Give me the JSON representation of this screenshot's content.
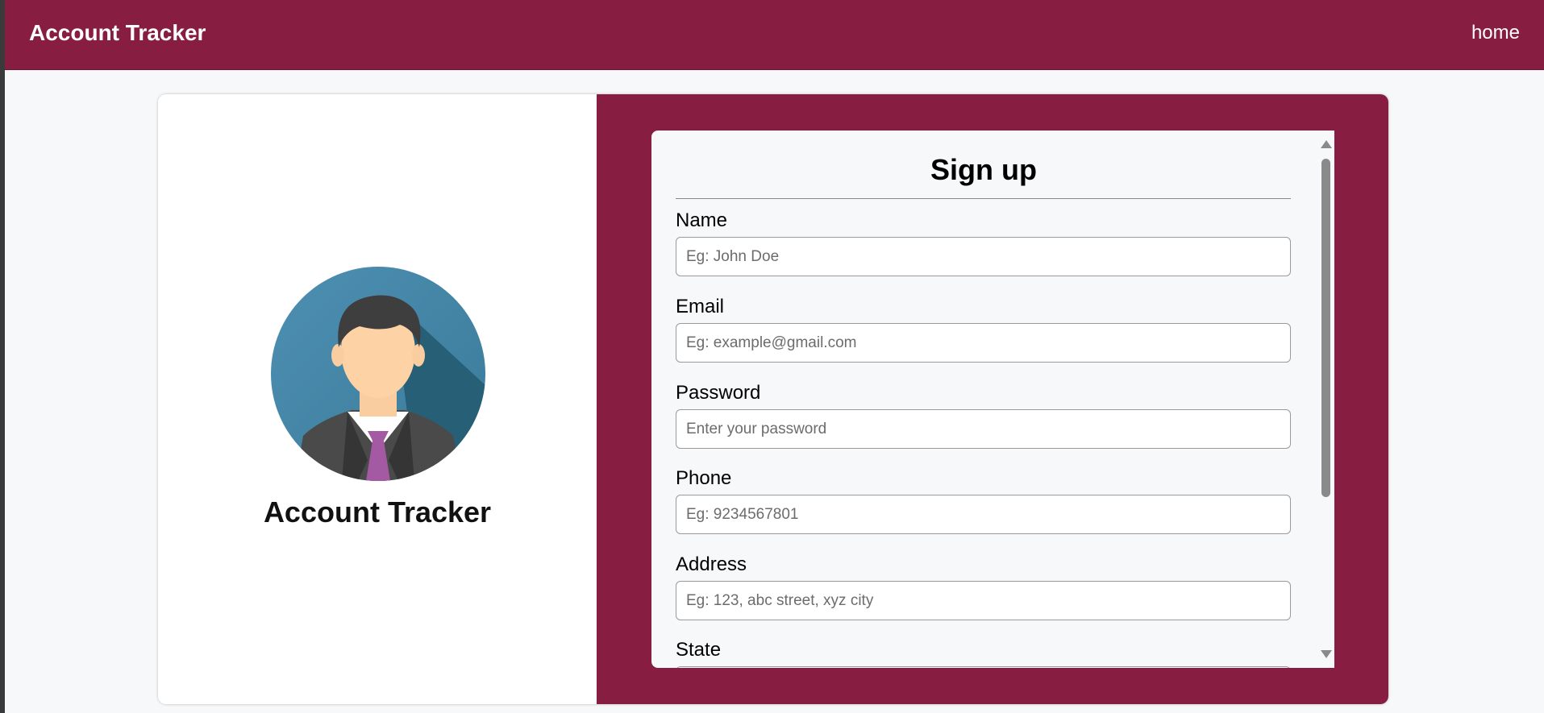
{
  "navbar": {
    "brand": "Account Tracker",
    "home_link": "home",
    "color": "#871e42"
  },
  "left_panel": {
    "avatar_icon": "businessman-avatar-icon",
    "title": "Account Tracker"
  },
  "signup_form": {
    "title": "Sign up",
    "fields": [
      {
        "label": "Name",
        "placeholder": "Eg: John Doe",
        "value": ""
      },
      {
        "label": "Email",
        "placeholder": "Eg: example@gmail.com",
        "value": ""
      },
      {
        "label": "Password",
        "placeholder": "Enter your password",
        "value": ""
      },
      {
        "label": "Phone",
        "placeholder": "Eg: 9234567801",
        "value": ""
      },
      {
        "label": "Address",
        "placeholder": "Eg: 123, abc street, xyz city",
        "value": ""
      },
      {
        "label": "State",
        "placeholder": "",
        "value": ""
      }
    ]
  },
  "colors": {
    "accent": "#871e42",
    "background": "#f7f8f9"
  }
}
